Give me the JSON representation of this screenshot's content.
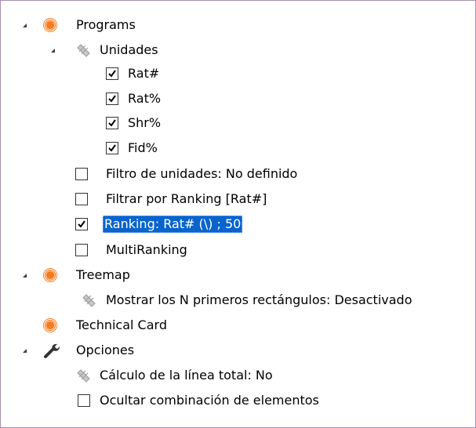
{
  "tree": {
    "programs": {
      "label": "Programs",
      "icon": "orange-radio-icon",
      "unidades": {
        "label": "Unidades",
        "icon": "disabled-tag-icon",
        "items": [
          {
            "label": "Rat#",
            "checked": true
          },
          {
            "label": "Rat%",
            "checked": true
          },
          {
            "label": "Shr%",
            "checked": true
          },
          {
            "label": "Fid%",
            "checked": true
          }
        ]
      },
      "options": [
        {
          "label": "Filtro de unidades: No definido",
          "checked": false
        },
        {
          "label": "Filtrar por Ranking [Rat#]",
          "checked": false
        },
        {
          "label": "Ranking: Rat# (\\) ; 50",
          "checked": true,
          "selected": true
        },
        {
          "label": "MultiRanking",
          "checked": false
        }
      ]
    },
    "treemap": {
      "label": "Treemap",
      "icon": "orange-radio-icon",
      "option": "Mostrar los N primeros rectángulos: Desactivado"
    },
    "technical_card": {
      "label": "Technical Card",
      "icon": "orange-radio-icon"
    },
    "opciones": {
      "label": "Opciones",
      "icon": "wrench-icon",
      "total_line": "Cálculo de la línea total: No",
      "hide_combination": {
        "label": "Ocultar combinación de elementos",
        "checked": false
      }
    }
  },
  "colors": {
    "accent_orange": "#f47b20",
    "selection": "#0a64cc",
    "border": "#a391b1"
  }
}
